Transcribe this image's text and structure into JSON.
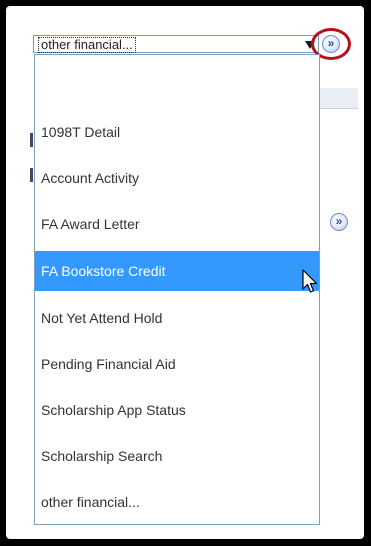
{
  "select": {
    "value": "other financial..."
  },
  "buttons": {
    "go_glyph": "»"
  },
  "dropdown": {
    "options": [
      "",
      "1098T Detail",
      "Account Activity",
      "FA Award Letter",
      "FA Bookstore Credit",
      "Not Yet Attend Hold",
      "Pending Financial Aid",
      "Scholarship App Status",
      "Scholarship Search",
      "other financial..."
    ],
    "highlighted": "FA Bookstore Credit"
  },
  "colors": {
    "highlight": "#3399ff",
    "callout_ring": "#b5121b",
    "border": "#7f9db9"
  },
  "icons": {
    "go": "double-chevron-right-icon",
    "cursor": "mouse-pointer-icon"
  }
}
